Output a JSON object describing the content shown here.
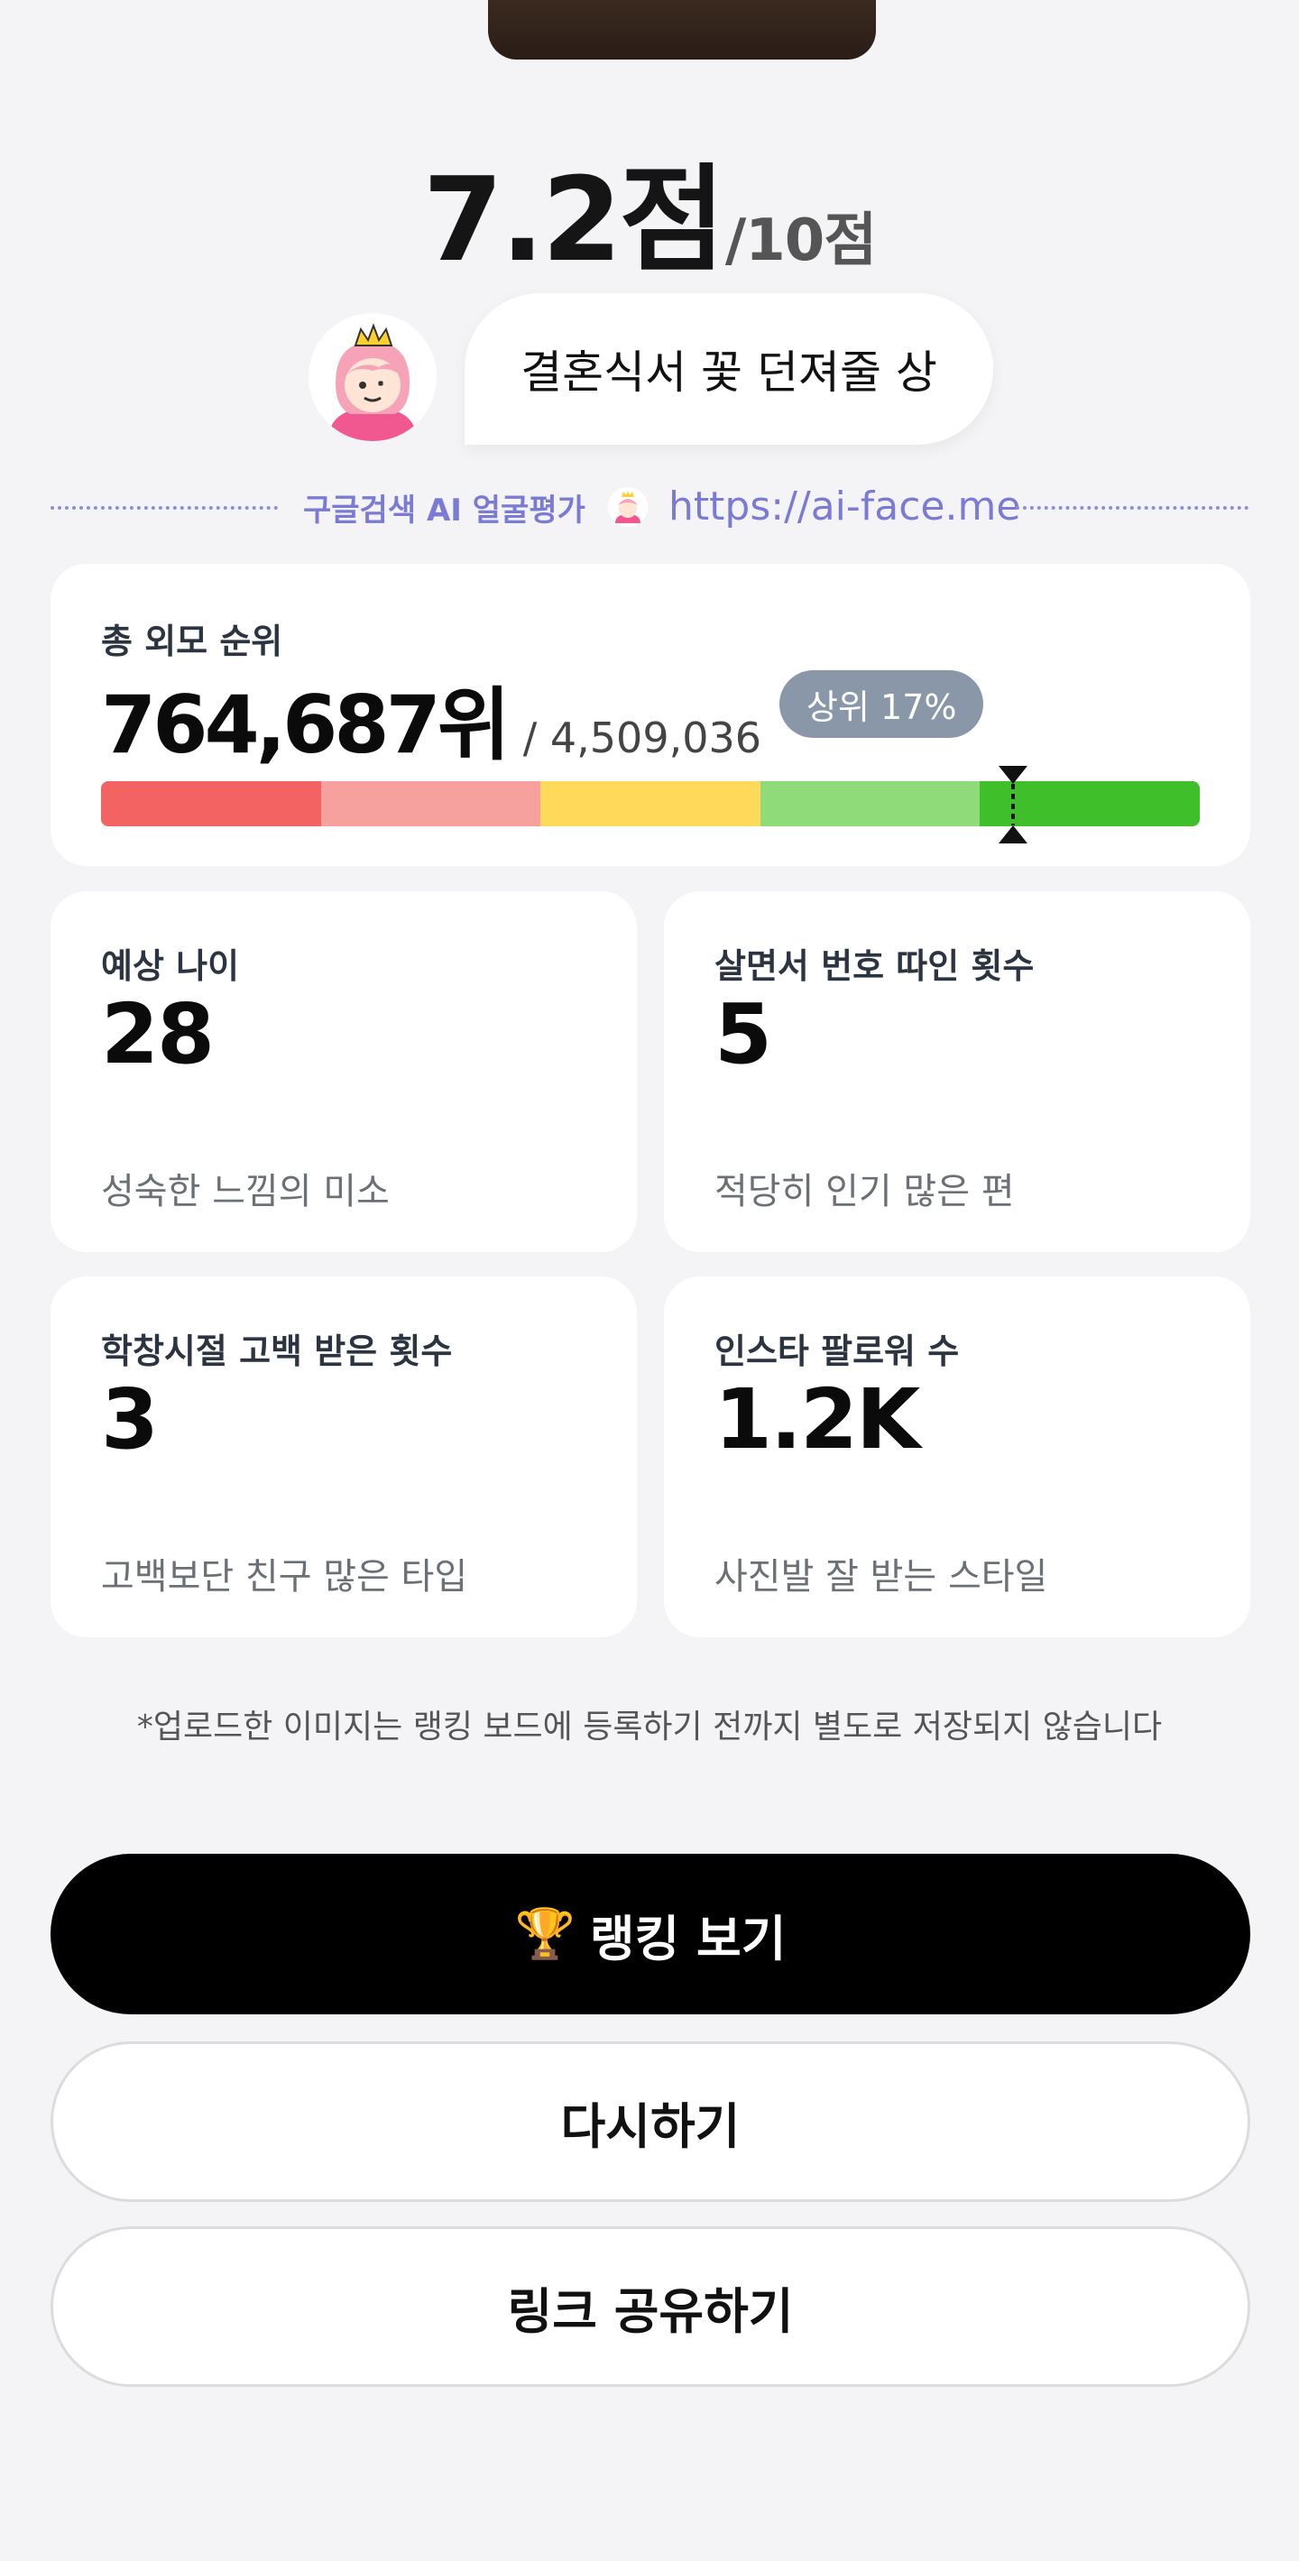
{
  "score": {
    "value": "7.2점",
    "max": "/10점"
  },
  "award": {
    "text": "결혼식서 꽃 던져줄 상"
  },
  "banner": {
    "brand": "구글검색 AI 얼굴평가",
    "url": "https://ai-face.me"
  },
  "rank": {
    "label": "총 외모 순위",
    "value": "764,687위",
    "total": "/ 4,509,036",
    "badge": "상위 17%",
    "percentile": 0.83,
    "segment_colors": [
      "#f26361",
      "#f7a19e",
      "#ffd95a",
      "#8fdb7a",
      "#3fbf2a"
    ]
  },
  "stats": [
    {
      "label": "예상 나이",
      "value": "28",
      "desc": "성숙한 느낌의 미소"
    },
    {
      "label": "살면서 번호 따인 횟수",
      "value": "5",
      "desc": "적당히 인기 많은 편"
    },
    {
      "label": "학창시절 고백 받은 횟수",
      "value": "3",
      "desc": "고백보단 친구 많은 타입"
    },
    {
      "label": "인스타 팔로워 수",
      "value": "1.2K",
      "desc": "사진발 잘 받는 스타일"
    }
  ],
  "notice": "*업로드한 이미지는 랭킹 보드에 등록하기 전까지 별도로 저장되지 않습니다",
  "buttons": {
    "ranking_icon": "🏆",
    "ranking": "랭킹 보기",
    "retry": "다시하기",
    "share": "링크 공유하기"
  }
}
